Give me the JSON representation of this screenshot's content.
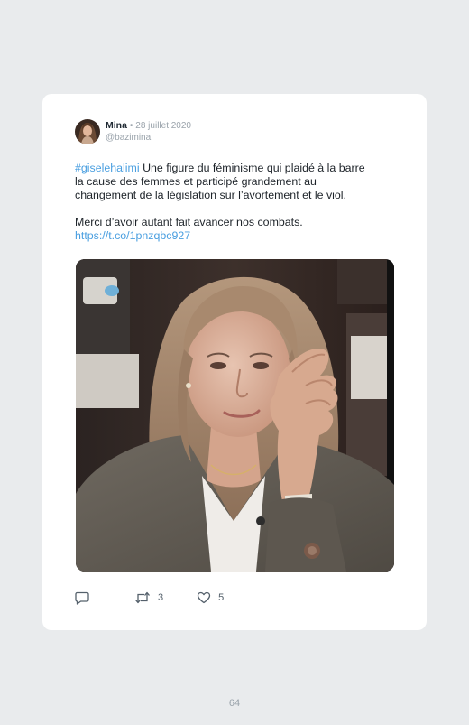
{
  "tweet": {
    "author": {
      "name": "Mina",
      "separator": "•",
      "date": "28 juillet 2020",
      "handle": "@bazimina"
    },
    "hashtag": "#giselehalimi",
    "text_line1": " Une figure du féminisme qui plaidé à la barre",
    "text_line2": "la cause des femmes et participé grandement au",
    "text_line3": "changement de la législation sur l’avortement et le viol.",
    "text_line4": "Merci d’avoir autant fait avancer nos combats.",
    "link": "https://t.co/1pnzqbc927",
    "retweet_count": "3",
    "like_count": "5"
  },
  "icons": {
    "reply": "reply-icon",
    "retweet": "retweet-icon",
    "like": "heart-icon"
  },
  "colors": {
    "background": "#e9ebed",
    "card": "#ffffff",
    "link": "#4a9fe0",
    "text": "#1d2329",
    "muted": "#9aa3ab"
  },
  "page": {
    "number": "64"
  }
}
